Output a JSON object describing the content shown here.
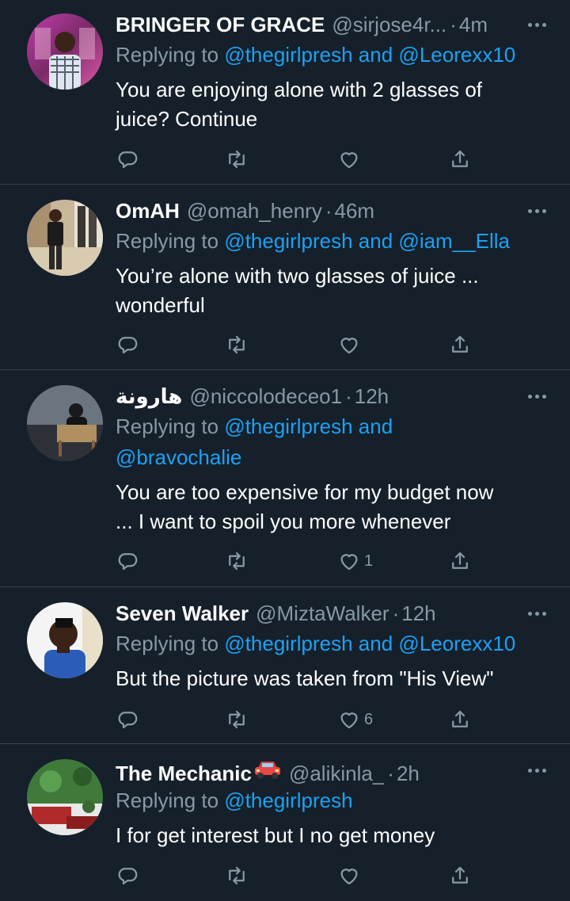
{
  "reply_prefix": "Replying to",
  "conjunction": "and",
  "tweets": [
    {
      "name": "BRINGER OF GRACE",
      "handle": "@sirjose4r...",
      "time": "4m",
      "mentions": [
        "@thegirlpresh",
        "@Leorexx10"
      ],
      "text_lines": [
        "You are enjoying alone with 2 glasses of",
        "juice? Continue"
      ],
      "like_count": ""
    },
    {
      "name": "OmAH",
      "handle": "@omah_henry",
      "time": "46m",
      "mentions": [
        "@thegirlpresh",
        "@iam__Ella"
      ],
      "text_lines": [
        "You’re alone with two glasses of juice ...",
        "wonderful"
      ],
      "like_count": ""
    },
    {
      "name": "هارونة",
      "handle": "@niccolodeceo1",
      "time": "12h",
      "mentions": [
        "@thegirlpresh",
        "@bravochalie"
      ],
      "text_lines": [
        "You are too expensive for my budget now",
        "... I want to spoil you more  whenever"
      ],
      "like_count": "1"
    },
    {
      "name": "Seven Walker",
      "handle": "@MiztaWalker",
      "time": "12h",
      "mentions": [
        "@thegirlpresh",
        "@Leorexx10"
      ],
      "text_lines": [
        "But the picture was taken from \"His View\""
      ],
      "like_count": "6"
    },
    {
      "name": "The Mechanic",
      "name_emoji": "car-emoji",
      "handle": "@alikinla_",
      "time": "2h",
      "mentions": [
        "@thegirlpresh"
      ],
      "text_lines": [
        "I for get interest but I no get money"
      ],
      "like_count": ""
    }
  ],
  "icons": {
    "reply": "reply-icon",
    "retweet": "retweet-icon",
    "like": "heart-icon",
    "share": "share-icon",
    "more": "more-icon"
  },
  "colors": {
    "background": "#15202b",
    "divider": "#38444d",
    "secondary_text": "#8899a6",
    "mention": "#1da1f2",
    "primary_text": "#ffffff"
  }
}
